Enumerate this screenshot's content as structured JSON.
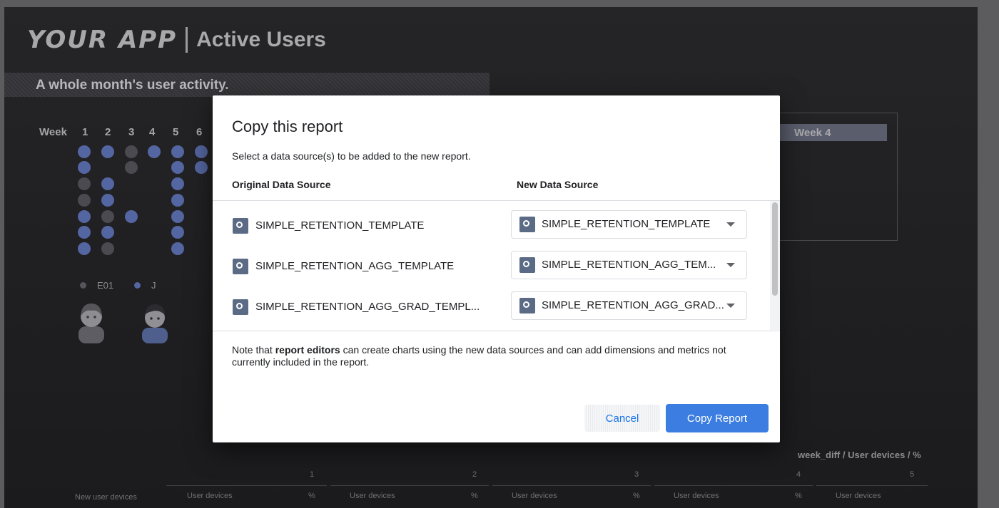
{
  "app": {
    "logo_text": "YOUR APP",
    "title": "Active Users",
    "subtitle": "A whole month's user activity."
  },
  "background_report": {
    "week_label": "Week",
    "weeks": [
      "1",
      "2",
      "3",
      "4",
      "5",
      "6"
    ],
    "legend": [
      "E01",
      "J"
    ],
    "panel_week_label": "Week 4",
    "table": {
      "title": "week_diff / User devices / %",
      "row_header": "New user devices",
      "columns": [
        {
          "num": "1",
          "head": "User devices",
          "pct": "%"
        },
        {
          "num": "2",
          "head": "User devices",
          "pct": "%"
        },
        {
          "num": "3",
          "head": "User devices",
          "pct": "%"
        },
        {
          "num": "4",
          "head": "User devices",
          "pct": "%"
        },
        {
          "num": "5",
          "head": "User devices",
          "pct": ""
        }
      ]
    }
  },
  "dialog": {
    "title": "Copy this report",
    "description": "Select a data source(s) to be added to the new report.",
    "original_header": "Original Data Source",
    "new_header": "New Data Source",
    "rows": [
      {
        "original": "SIMPLE_RETENTION_TEMPLATE",
        "selected": "SIMPLE_RETENTION_TEMPLATE"
      },
      {
        "original": "SIMPLE_RETENTION_AGG_TEMPLATE",
        "selected": "SIMPLE_RETENTION_AGG_TEM..."
      },
      {
        "original": "SIMPLE_RETENTION_AGG_GRAD_TEMPL...",
        "selected": "SIMPLE_RETENTION_AGG_GRAD..."
      }
    ],
    "note_prefix": "Note that ",
    "note_bold": "report editors",
    "note_suffix": " can create charts using the new data sources and can add dimensions and metrics not currently included in the report.",
    "cancel_label": "Cancel",
    "copy_label": "Copy Report"
  }
}
